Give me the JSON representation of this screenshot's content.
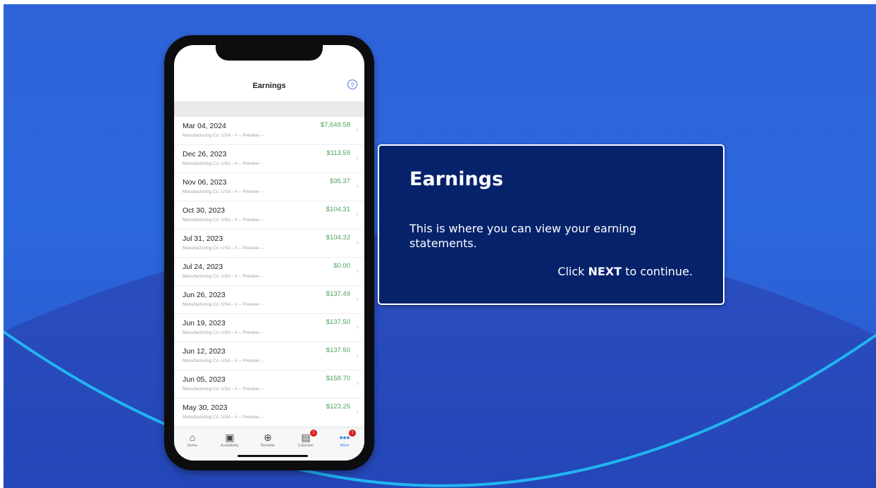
{
  "colors": {
    "background": "#2b67dc",
    "arc": "#22b4f0",
    "callout_bg": "#06226b",
    "amount_green": "#4ca35a",
    "accent_blue": "#3a7be0",
    "badge_red": "#d91b1b"
  },
  "phone": {
    "header_title": "Earnings",
    "help_icon": "?",
    "rows": [
      {
        "date": "Mar 04, 2024",
        "sub": "Manufacturing Co. USA - # -- Preview --",
        "amount": "$7,649.58"
      },
      {
        "date": "Dec 26, 2023",
        "sub": "Manufacturing Co. USA - # -- Preview --",
        "amount": "$113.59"
      },
      {
        "date": "Nov 06, 2023",
        "sub": "Manufacturing Co. USA - # -- Preview --",
        "amount": "$35.37"
      },
      {
        "date": "Oct 30, 2023",
        "sub": "Manufacturing Co. USA - # -- Preview --",
        "amount": "$104.31"
      },
      {
        "date": "Jul 31, 2023",
        "sub": "Manufacturing Co. USA - # -- Preview --",
        "amount": "$104.32"
      },
      {
        "date": "Jul 24, 2023",
        "sub": "Manufacturing Co. USA - # -- Preview --",
        "amount": "$0.00"
      },
      {
        "date": "Jun 26, 2023",
        "sub": "Manufacturing Co. USA - # -- Preview --",
        "amount": "$137.49"
      },
      {
        "date": "Jun 19, 2023",
        "sub": "Manufacturing Co. USA - # -- Preview --",
        "amount": "$137.50"
      },
      {
        "date": "Jun 12, 2023",
        "sub": "Manufacturing Co. USA - # -- Preview --",
        "amount": "$137.50"
      },
      {
        "date": "Jun 05, 2023",
        "sub": "Manufacturing Co. USA - # -- Preview --",
        "amount": "$158.70"
      },
      {
        "date": "May 30, 2023",
        "sub": "Manufacturing Co. USA - # -- Preview --",
        "amount": "$123.25"
      }
    ],
    "tabs": [
      {
        "label": "Home",
        "icon": "home-icon"
      },
      {
        "label": "Availability",
        "icon": "availability-icon"
      },
      {
        "label": "Benefits",
        "icon": "plus-circle-icon"
      },
      {
        "label": "Calendar",
        "icon": "calendar-icon",
        "badge": "1"
      },
      {
        "label": "More",
        "icon": "more-icon",
        "badge": "1",
        "active": true
      }
    ]
  },
  "callout": {
    "title": "Earnings",
    "body": "This is where you can view your earning statements.",
    "next_prefix": "Click ",
    "next_bold": "NEXT",
    "next_suffix": " to continue."
  }
}
